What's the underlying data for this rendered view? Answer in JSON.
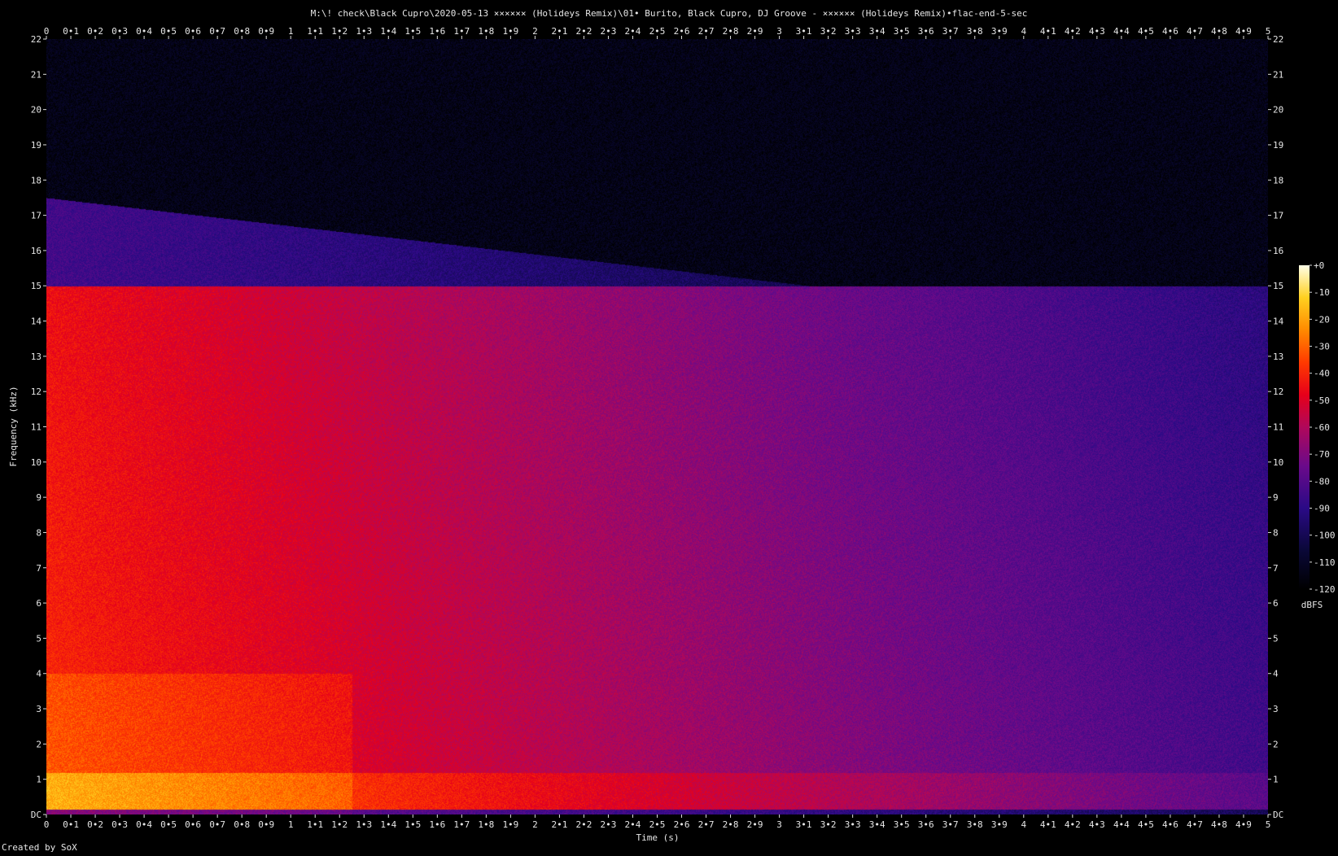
{
  "chart_data": {
    "type": "heatmap",
    "title": "M:\\! check\\Black Cupro\\2020-05-13  ×××××× (Holideys Remix)\\01• Burito, Black Cupro, DJ Groove - ×××××× (Holideys Remix)•flac-end-5-sec",
    "xlabel": "Time (s)",
    "ylabel": "Frequency (kHz)",
    "xlim": [
      0,
      5
    ],
    "ylim": [
      0,
      22
    ],
    "x_ticks": [
      "0",
      "0•1",
      "0•2",
      "0•3",
      "0•4",
      "0•5",
      "0•6",
      "0•7",
      "0•8",
      "0•9",
      "1",
      "1•1",
      "1•2",
      "1•3",
      "1•4",
      "1•5",
      "1•6",
      "1•7",
      "1•8",
      "1•9",
      "2",
      "2•1",
      "2•2",
      "2•3",
      "2•4",
      "2•5",
      "2•6",
      "2•7",
      "2•8",
      "2•9",
      "3",
      "3•1",
      "3•2",
      "3•3",
      "3•4",
      "3•5",
      "3•6",
      "3•7",
      "3•8",
      "3•9",
      "4",
      "4•1",
      "4•2",
      "4•3",
      "4•4",
      "4•5",
      "4•6",
      "4•7",
      "4•8",
      "4•9",
      "5"
    ],
    "y_ticks": [
      "DC",
      "1",
      "2",
      "3",
      "4",
      "5",
      "6",
      "7",
      "8",
      "9",
      "10",
      "11",
      "12",
      "13",
      "14",
      "15",
      "16",
      "17",
      "18",
      "19",
      "20",
      "21",
      "22"
    ],
    "colorbar": {
      "label": "dBFS",
      "ticks": [
        "+0",
        "-10",
        "-20",
        "-30",
        "-40",
        "-50",
        "-60",
        "-70",
        "-80",
        "-90",
        "-100",
        "-110",
        "-120"
      ],
      "range": [
        -120,
        0
      ]
    },
    "features": {
      "lowpass_cutoff_khz_start": 17.5,
      "lowpass_cutoff_khz_end": 15.0,
      "secondary_band_khz": 15.0,
      "energy_trend": "decreasing over time (fade-out)"
    },
    "footer": "Created by SoX"
  }
}
